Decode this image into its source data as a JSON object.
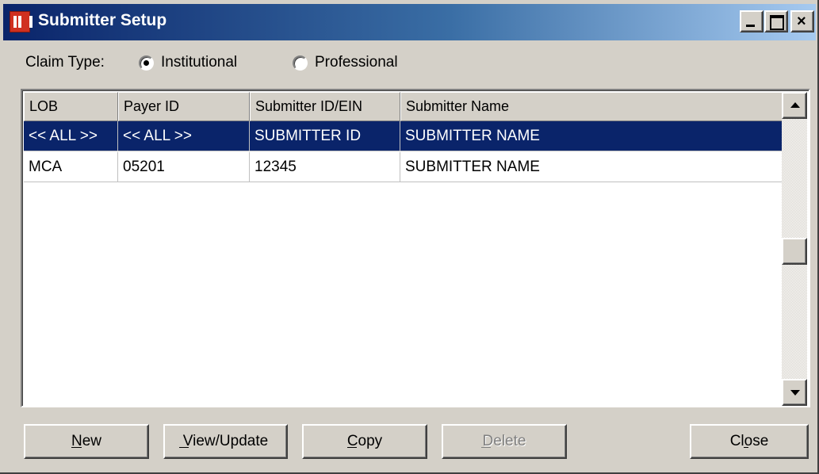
{
  "window": {
    "title": "Submitter Setup",
    "icon": "app-icon"
  },
  "claim_type": {
    "label": "Claim Type:",
    "options": [
      {
        "label": "Institutional",
        "selected": true
      },
      {
        "label": "Professional",
        "selected": false
      }
    ]
  },
  "grid": {
    "columns": [
      "LOB",
      "Payer ID",
      "Submitter ID/EIN",
      "Submitter Name"
    ],
    "rows": [
      {
        "lob": "<< ALL >>",
        "payer_id": "<< ALL >>",
        "submitter_id": "SUBMITTER ID",
        "submitter_name": "SUBMITTER NAME",
        "selected": true
      },
      {
        "lob": "MCA",
        "payer_id": "05201",
        "submitter_id": "12345",
        "submitter_name": "SUBMITTER NAME",
        "selected": false
      }
    ]
  },
  "buttons": {
    "new": "New",
    "view_update": "View/Update",
    "copy": "Copy",
    "delete": "Delete",
    "close": "Close"
  },
  "colors": {
    "selection": "#0a246a",
    "face": "#d4d0c8"
  }
}
